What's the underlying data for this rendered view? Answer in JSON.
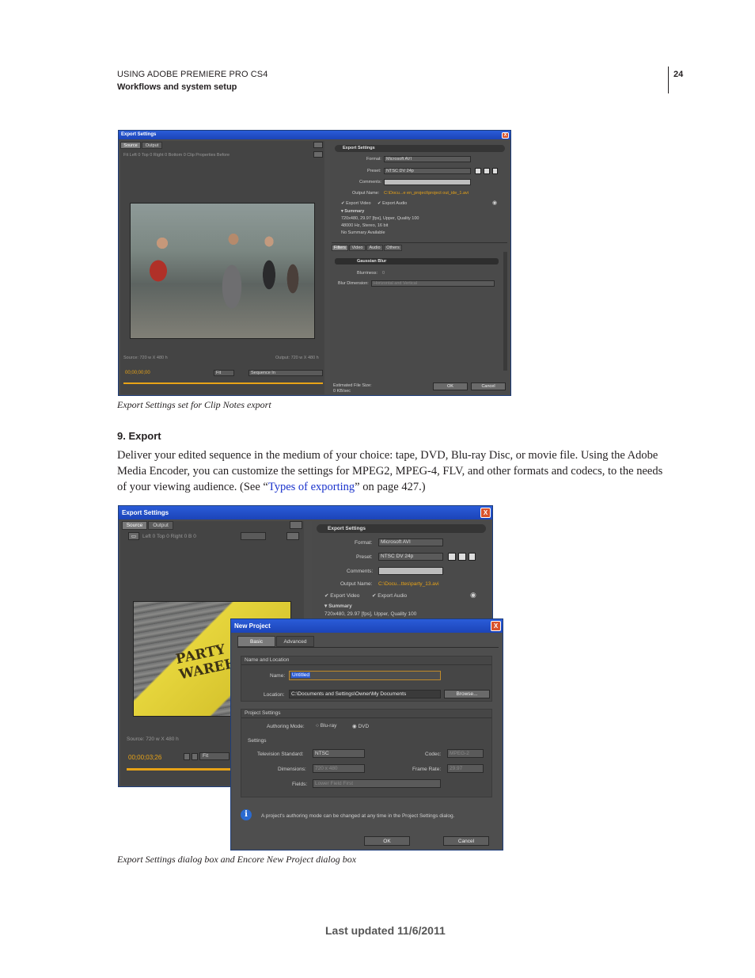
{
  "header": {
    "line1": "USING ADOBE PREMIERE PRO CS4",
    "line2": "Workflows and system setup",
    "page_number": "24"
  },
  "figure1": {
    "title": "Export Settings",
    "close": "X",
    "tabs": [
      "Source",
      "Output"
    ],
    "toolbar": "Fit  Left  0  Top  0  Right  0  Bottom  0  Clip Properties  Before",
    "source_info": "Source: 720 w X 480 h",
    "output_info": "Output: 720 w X 480 h",
    "timecode": "00;00;00;00",
    "fit": "Fit",
    "range": "Sequence In",
    "settings_header": "Export Settings",
    "format_label": "Format:",
    "format_value": "Microsoft AVI",
    "preset_label": "Preset:",
    "preset_value": "NTSC DV 24p",
    "comments_label": "Comments:",
    "output_name_label": "Output Name:",
    "output_name_value": "C:\\Docu...e en_project\\project out_ide_1.avi",
    "export_video": "Export Video",
    "export_audio": "Export Audio",
    "summary_label": "Summary",
    "summary_lines": [
      "720x480, 29.97 [fps], Upper, Quality 100",
      "48000 Hz, Stereo, 16 bit",
      "No Summary Available"
    ],
    "lower_tabs": [
      "Filters",
      "Video",
      "Audio",
      "Others"
    ],
    "filter_header": "Gaussian Blur",
    "blurriness_label": "Blurriness:",
    "blurriness_value": "0",
    "blur_dimension_label": "Blur Dimension:",
    "blur_dimension_value": "Horizontal and Vertical",
    "estimated_label": "Estimated File Size:",
    "estimated_value": "0 KB/sec",
    "ok": "OK",
    "cancel": "Cancel"
  },
  "caption1": "Export Settings set for Clip Notes export",
  "section_heading": "9.  Export",
  "paragraph": {
    "before": "Deliver your edited sequence in the medium of your choice: tape, DVD, Blu-ray Disc, or movie file. Using the Adobe Media Encoder, you can customize the settings for MPEG2, MPEG-4, FLV, and other formats and codecs, to the needs of your viewing audience. (See “",
    "link": "Types of exporting",
    "after": "” on page 427.)"
  },
  "figure2": {
    "title": "Export Settings",
    "close": "X",
    "tabs": [
      "Source",
      "Output"
    ],
    "toolbar": "Left  0  Top  0  Right  0  B  0",
    "source_info": "Source: 720 w X 480 h",
    "timecode": "00;00;03;26",
    "fit": "Fit",
    "settings_header": "Export Settings",
    "format_label": "Format:",
    "format_value": "Microsoft AVI",
    "preset_label": "Preset:",
    "preset_value": "NTSC DV 24p",
    "comments_label": "Comments:",
    "output_name_label": "Output Name:",
    "output_name_value": "C:\\Docu...ttes\\party_13.avi",
    "export_video": "Export Video",
    "export_audio": "Export Audio",
    "summary_label": "Summary",
    "summary_line": "720x480, 29.97 [fps], Upper, Quality 100",
    "photo_text": "PARTY #13 WAREHOUSE"
  },
  "new_project": {
    "title": "New Project",
    "close": "X",
    "tabs": [
      "Basic",
      "Advanced"
    ],
    "name_location_header": "Name and Location",
    "name_label": "Name:",
    "name_value": "Untitled",
    "location_label": "Location:",
    "location_value": "C:\\Documents and Settings\\Owner\\My Documents",
    "browse": "Browse...",
    "project_settings_header": "Project Settings",
    "authoring_label": "Authoring Mode:",
    "bluray": "Blu-ray",
    "dvd": "DVD",
    "settings_header": "Settings",
    "tv_standard_label": "Television Standard:",
    "tv_standard_value": "NTSC",
    "codec_label": "Codec:",
    "codec_value": "MPEG-2",
    "dimensions_label": "Dimensions:",
    "dimensions_value": "720 x 480",
    "frame_rate_label": "Frame Rate:",
    "frame_rate_value": "29.97",
    "fields_label": "Fields:",
    "fields_value": "Lower Field First",
    "info_text": "A project's authoring mode can be changed at any time in the Project Settings dialog.",
    "ok": "OK",
    "cancel": "Cancel"
  },
  "caption2": "Export Settings dialog box and Encore New Project dialog box",
  "footer": "Last updated 11/6/2011"
}
